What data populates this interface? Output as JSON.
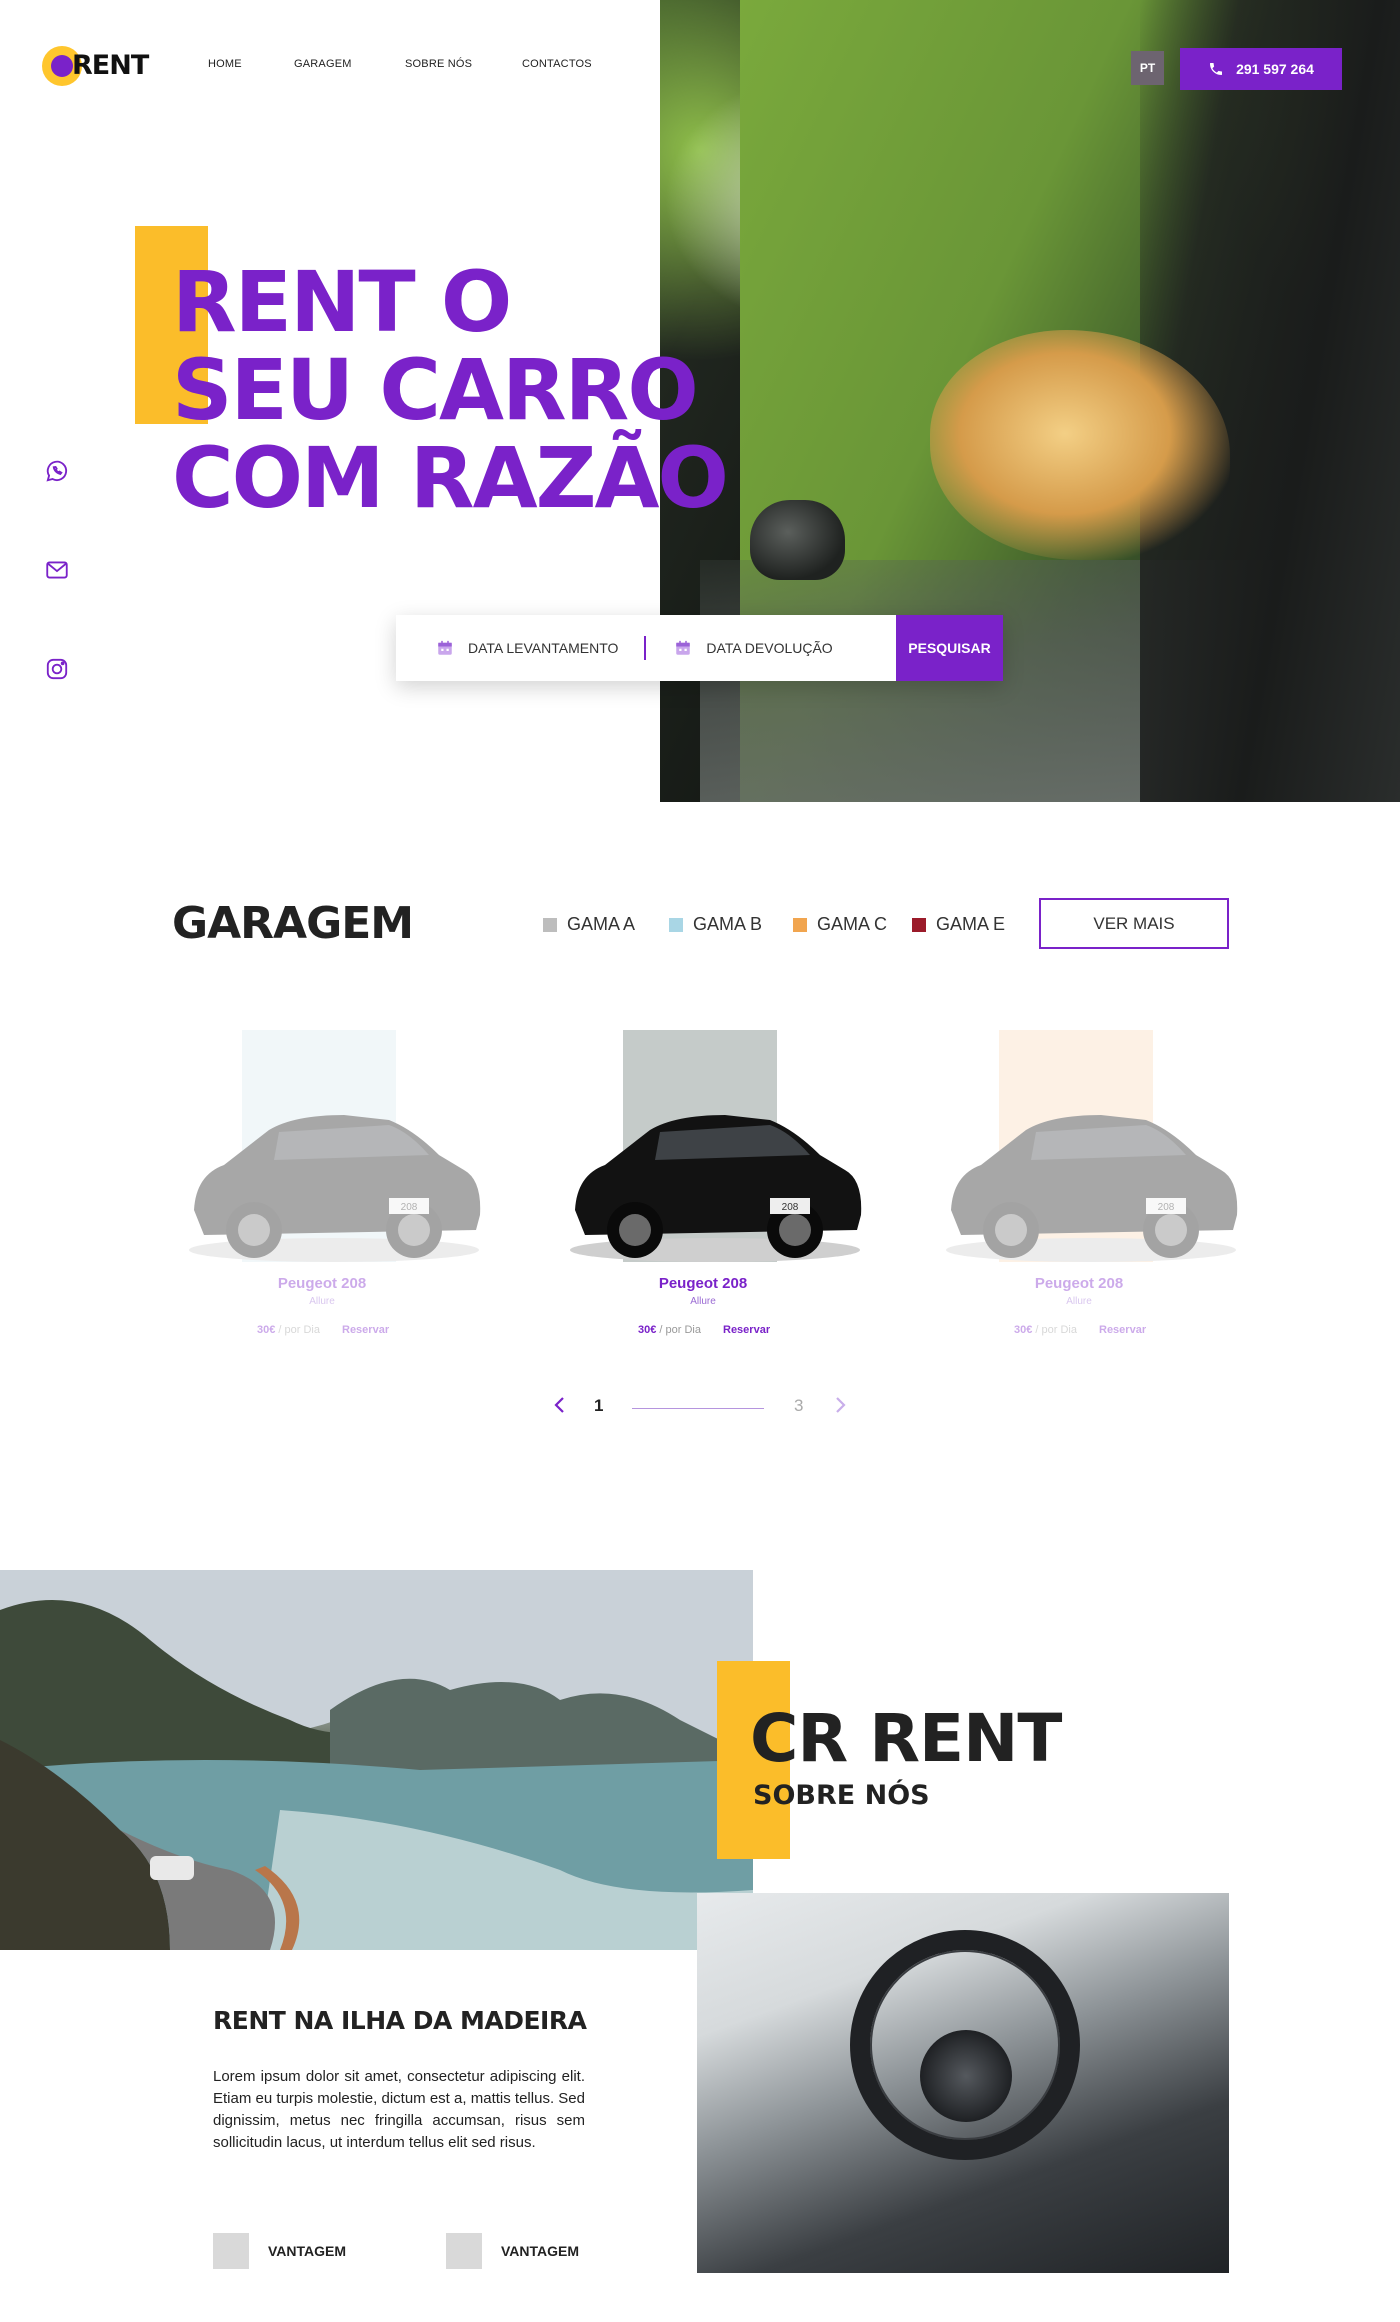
{
  "brand": {
    "logo_text": "RENT",
    "primary_color": "#7a22c9",
    "accent_color": "#fbbd2a"
  },
  "nav": {
    "items": [
      "HOME",
      "GARAGEM",
      "SOBRE NÓS",
      "CONTACTOS"
    ]
  },
  "header": {
    "lang": "PT",
    "phone": "291 597 264",
    "phone_icon": "phone-icon"
  },
  "hero": {
    "title": "RENT O\nSEU CARRO\nCOM RAZÃO",
    "search": {
      "pickup_label": "DATA LEVANTAMENTO",
      "return_label": "DATA DEVOLUÇÃO",
      "button_label": "PESQUISAR"
    }
  },
  "social": [
    "whatsapp-icon",
    "mail-icon",
    "instagram-icon"
  ],
  "garagem": {
    "title": "GARAGEM",
    "legend": [
      {
        "label": "GAMA A",
        "color": "#bdbdbd"
      },
      {
        "label": "GAMA B",
        "color": "#a9d6e5"
      },
      {
        "label": "GAMA C",
        "color": "#f1a54f"
      },
      {
        "label": "GAMA E",
        "color": "#9b1b2a"
      }
    ],
    "ver_mais": "VER MAIS",
    "cars": [
      {
        "name": "Peugeot 208",
        "trim": "Allure",
        "price": "30€",
        "unit": " / por Dia",
        "reserve": "Reservar",
        "bg_color": "#dcebf1",
        "plate": "208",
        "active": false
      },
      {
        "name": "Peugeot 208",
        "trim": "Allure",
        "price": "30€",
        "unit": " / por Dia",
        "reserve": "Reservar",
        "bg_color": "#c5cbc9",
        "plate": "208",
        "active": true
      },
      {
        "name": "Peugeot 208",
        "trim": "Allure",
        "price": "30€",
        "unit": " / por Dia",
        "reserve": "Reservar",
        "bg_color": "#fbdcbd",
        "plate": "208",
        "active": false
      }
    ],
    "pager": {
      "current": "1",
      "total": "3"
    }
  },
  "about": {
    "title": "CR RENT",
    "subtitle": "SOBRE NÓS",
    "heading": "RENT NA ILHA DA MADEIRA",
    "text": "Lorem ipsum dolor sit amet, consectetur adipiscing elit. Etiam eu turpis molestie, dictum est a, mattis tellus. Sed dignissim, metus nec fringilla accumsan, risus sem sollicitudin lacus, ut interdum tellus elit sed risus.",
    "vantagens": [
      "VANTAGEM",
      "VANTAGEM"
    ]
  }
}
